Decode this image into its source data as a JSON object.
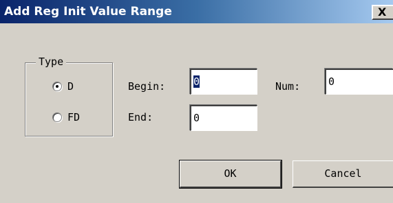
{
  "window": {
    "title": "Add Reg Init Value Range",
    "close_label": "X"
  },
  "type_group": {
    "legend": "Type",
    "options": [
      {
        "label": "D",
        "selected": true
      },
      {
        "label": "FD",
        "selected": false
      }
    ]
  },
  "fields": {
    "begin_label": "Begin:",
    "begin_value": "0",
    "num_label": "Num:",
    "num_value": "0",
    "end_label": "End:",
    "end_value": "0"
  },
  "buttons": {
    "ok_label": "OK",
    "cancel_label": "Cancel"
  },
  "colors": {
    "title_bar_start": "#0a246a",
    "title_bar_end": "#a6caf0",
    "dialog_face": "#d4d0c8",
    "selection": "#0a246a"
  }
}
